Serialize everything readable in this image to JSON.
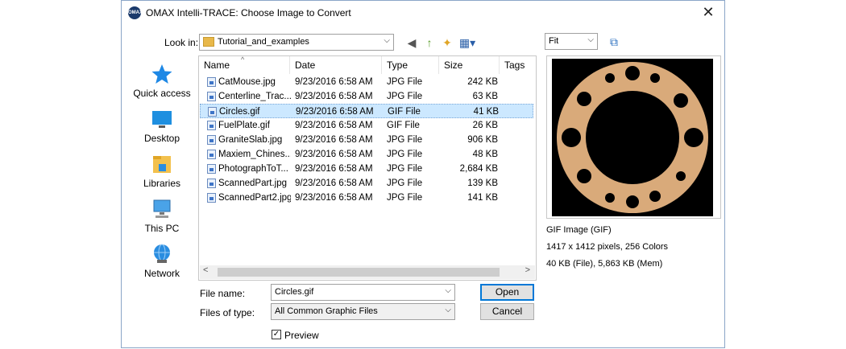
{
  "window": {
    "title": "OMAX Intelli-TRACE: Choose Image to Convert",
    "logo_text": "OMAX",
    "close_glyph": "✕"
  },
  "lookin": {
    "label": "Look in:",
    "value": "Tutorial_and_examples"
  },
  "toolbar": {
    "back_glyph": "◀",
    "up_glyph": "↑",
    "newfolder_glyph": "✦",
    "views_glyph": "▦▾"
  },
  "places": [
    {
      "label": "Quick access",
      "icon": "star-icon"
    },
    {
      "label": "Desktop",
      "icon": "desktop-icon"
    },
    {
      "label": "Libraries",
      "icon": "libraries-icon"
    },
    {
      "label": "This PC",
      "icon": "computer-icon"
    },
    {
      "label": "Network",
      "icon": "network-icon"
    }
  ],
  "columns": {
    "name": "Name",
    "date": "Date",
    "type": "Type",
    "size": "Size",
    "tags": "Tags"
  },
  "files": [
    {
      "name": "CatMouse.jpg",
      "date": "9/23/2016 6:58 AM",
      "type": "JPG File",
      "size": "242 KB"
    },
    {
      "name": "Centerline_Trac...",
      "date": "9/23/2016 6:58 AM",
      "type": "JPG File",
      "size": "63 KB"
    },
    {
      "name": "Circles.gif",
      "date": "9/23/2016 6:58 AM",
      "type": "GIF File",
      "size": "41 KB"
    },
    {
      "name": "FuelPlate.gif",
      "date": "9/23/2016 6:58 AM",
      "type": "GIF File",
      "size": "26 KB"
    },
    {
      "name": "GraniteSlab.jpg",
      "date": "9/23/2016 6:58 AM",
      "type": "JPG File",
      "size": "906 KB"
    },
    {
      "name": "Maxiem_Chines...",
      "date": "9/23/2016 6:58 AM",
      "type": "JPG File",
      "size": "48 KB"
    },
    {
      "name": "PhotographToT...",
      "date": "9/23/2016 6:58 AM",
      "type": "JPG File",
      "size": "2,684 KB"
    },
    {
      "name": "ScannedPart.jpg",
      "date": "9/23/2016 6:58 AM",
      "type": "JPG File",
      "size": "139 KB"
    },
    {
      "name": "ScannedPart2.jpg",
      "date": "9/23/2016 6:58 AM",
      "type": "JPG File",
      "size": "141 KB"
    }
  ],
  "filename": {
    "label": "File name:",
    "value": "Circles.gif"
  },
  "filetype": {
    "label": "Files of type:",
    "value": "All Common Graphic Files"
  },
  "buttons": {
    "open": "Open",
    "cancel": "Cancel"
  },
  "preview": {
    "label": "Preview",
    "checked": true,
    "fit_value": "Fit"
  },
  "info": {
    "format": "GIF Image (GIF)",
    "dims": "1417 x 1412 pixels, 256 Colors",
    "size": "40 KB (File), 5,863 KB (Mem)"
  },
  "colors": {
    "selection": "#cce8ff",
    "ring": "#d9aa7a",
    "accent": "#0078d7"
  }
}
